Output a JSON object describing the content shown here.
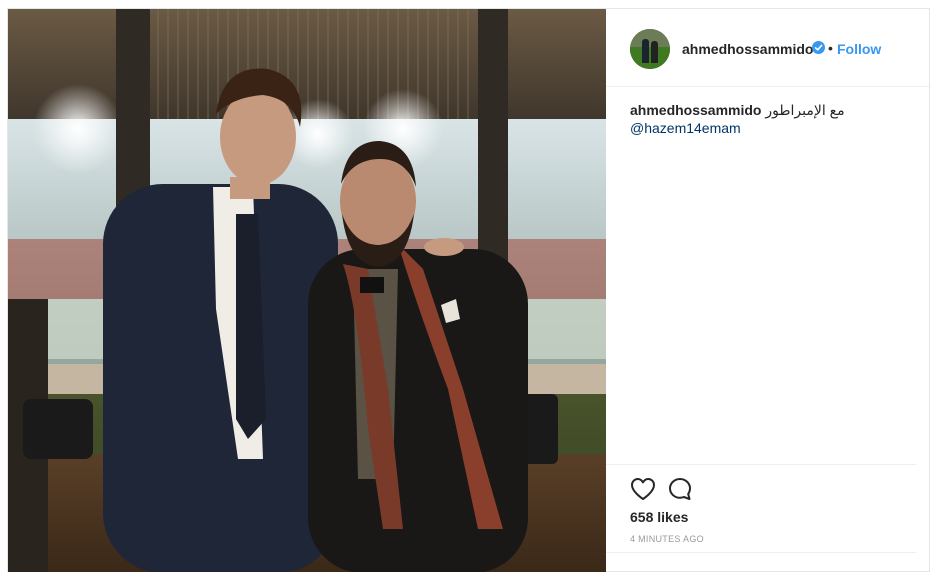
{
  "post": {
    "photo": {
      "alt": ""
    },
    "header": {
      "username": "ahmedhossammido",
      "separator": "•",
      "follow_label": "Follow"
    },
    "caption": {
      "username": "ahmedhossammido",
      "text": "مع الإمبراطور",
      "mention": "@hazem14emam"
    },
    "actions": {
      "like_icon": "heart-icon",
      "comment_icon": "comment-icon"
    },
    "likes": "658 likes",
    "timestamp": "4 MINUTES AGO",
    "colors": {
      "link": "#3897f0",
      "mention": "#003569",
      "text": "#262626",
      "muted": "#999999",
      "border": "#efefef"
    }
  }
}
